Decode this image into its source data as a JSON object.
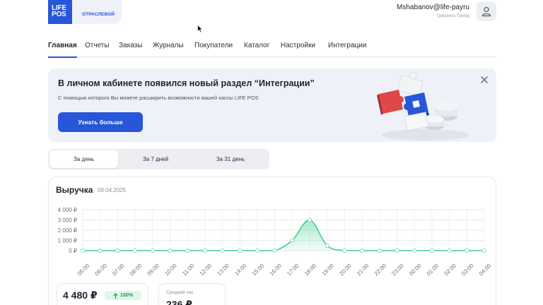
{
  "header": {
    "logo_text_line1": "LIFE",
    "logo_text_line2": "POS",
    "org_label": "ОТРАСЛЕВОЙ",
    "user_email": "Mshabanov@life-payru",
    "user_company": "Гришина Трейд"
  },
  "nav": {
    "items": [
      "Главная",
      "Отчеты",
      "Заказы",
      "Журналы",
      "Покупатели",
      "Каталог",
      "Настройки",
      "Интеграции"
    ],
    "active": "Главная"
  },
  "banner": {
    "title": "В личном кабинете появился новый раздел “Интеграции”",
    "text": "С помощью которого Вы можете расширить возможности вашей кассы LIFE POS",
    "button_label": "Узнать больше"
  },
  "periods": {
    "items": [
      "За день",
      "За 7 дней",
      "За 31 день"
    ],
    "active": "За день"
  },
  "revenue": {
    "title": "Выручка",
    "date": "08.04.2025"
  },
  "chart_data": {
    "type": "area",
    "x": [
      "05:00",
      "06:00",
      "07:00",
      "08:00",
      "09:00",
      "10:00",
      "11:00",
      "12:00",
      "13:00",
      "14:00",
      "15:00",
      "16:00",
      "17:00",
      "18:00",
      "19:00",
      "20:00",
      "21:00",
      "22:00",
      "23:00",
      "00:00",
      "01:00",
      "02:00",
      "03:00",
      "04:00"
    ],
    "series": [
      {
        "values": [
          0,
          0,
          0,
          0,
          0,
          0,
          0,
          0,
          0,
          0,
          0,
          0,
          1000,
          3000,
          480,
          0,
          0,
          0,
          0,
          0,
          0,
          0,
          0,
          0
        ]
      }
    ],
    "yticks": [
      "4 000 ₽",
      "3 000 ₽",
      "2 000 ₽",
      "1 000 ₽",
      "0 ₽"
    ],
    "ylim": [
      0,
      4000
    ],
    "grid": true,
    "color": "#3ecf8e"
  },
  "metrics": {
    "revenue_value": "4 480 ₽",
    "revenue_change": "100%",
    "avg_check_label": "Средний чек",
    "avg_check_value": "236 ₽"
  },
  "colors": {
    "brand": "#2756d8",
    "accent_green": "#3ecf8e"
  }
}
